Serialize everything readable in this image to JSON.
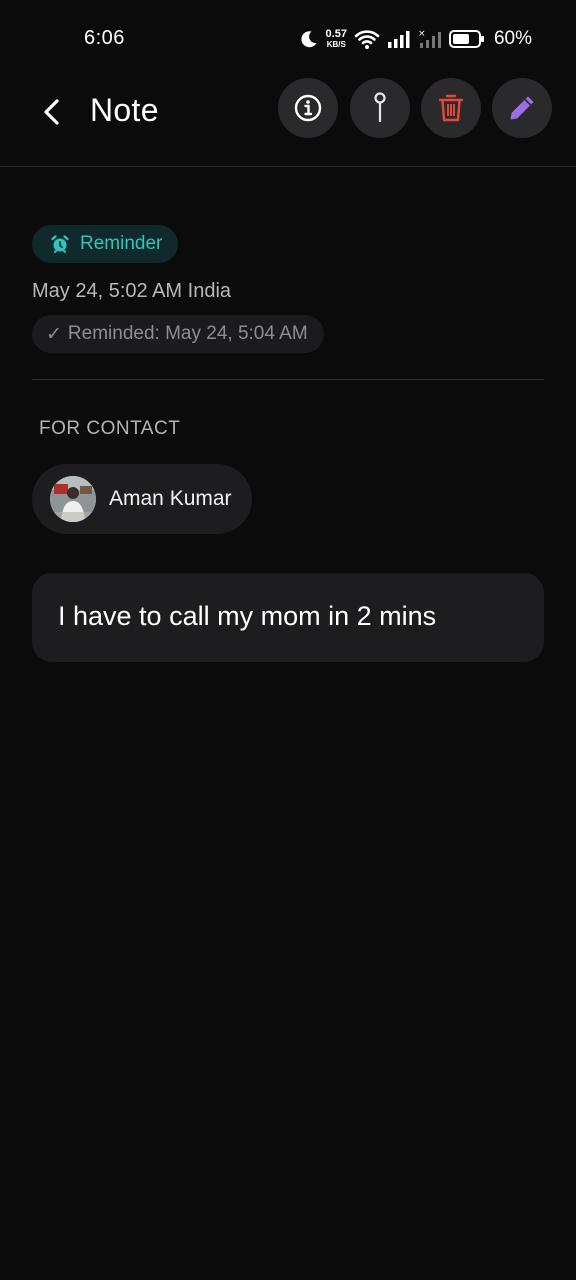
{
  "status_bar": {
    "time": "6:06",
    "net_speed_value": "0.57",
    "net_speed_unit": "KB/S",
    "battery_percent": "60%"
  },
  "header": {
    "title": "Note",
    "actions": [
      "info-icon",
      "pin-icon",
      "trash-icon",
      "pencil-icon"
    ]
  },
  "reminder": {
    "label": "Reminder",
    "datetime": "May 24, 5:02 AM India",
    "reminded_check": "✓",
    "reminded_text": "Reminded: May 24, 5:04 AM"
  },
  "contact_section": {
    "label": "FOR CONTACT",
    "contact_name": "Aman Kumar"
  },
  "note": {
    "text": "I have to call my mom in 2 mins"
  },
  "colors": {
    "background": "#0b0b0c",
    "reminder_accent": "#2ec4bf",
    "delete_red": "#e5483d",
    "edit_purple": "#9b6ee8"
  }
}
